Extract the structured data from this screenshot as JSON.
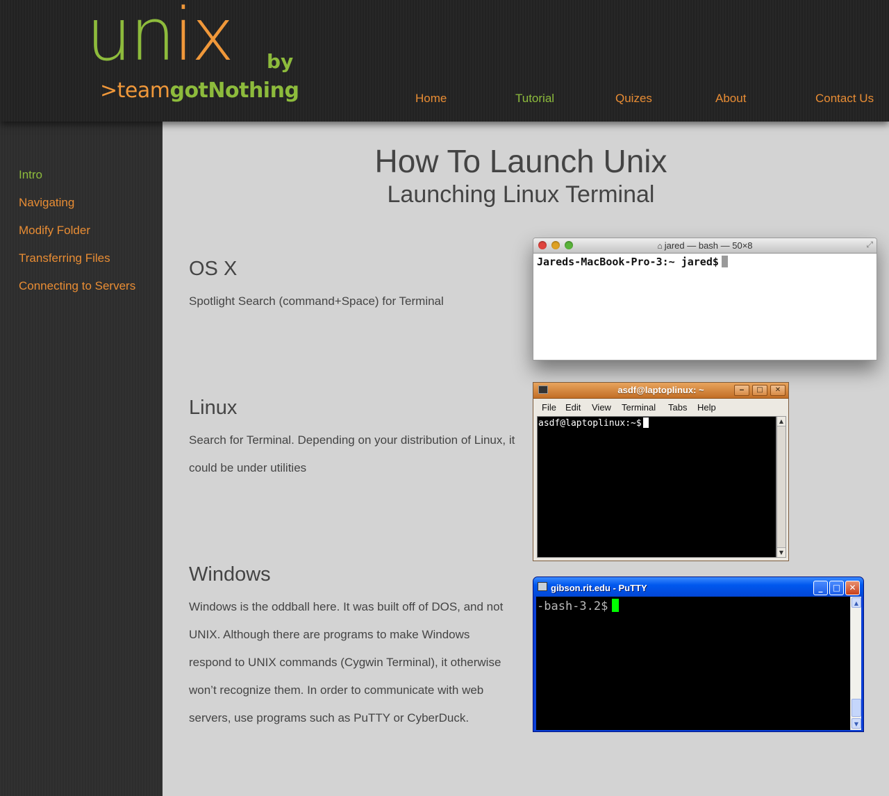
{
  "logo": {
    "unix_part1": "un",
    "unix_part2": "ix",
    "by": "by",
    "team_prefix": ">team",
    "team_name": "gotNothing"
  },
  "nav": {
    "items": [
      {
        "label": "Home"
      },
      {
        "label": "Tutorial"
      },
      {
        "label": "Quizes"
      },
      {
        "label": "About"
      },
      {
        "label": "Contact Us"
      }
    ],
    "active_index": 1
  },
  "sidebar": {
    "items": [
      {
        "label": "Intro"
      },
      {
        "label": "Navigating"
      },
      {
        "label": "Modify Folder"
      },
      {
        "label": "Transferring Files"
      },
      {
        "label": "Connecting to Servers"
      }
    ],
    "active_index": 0
  },
  "main": {
    "title": "How To Launch Unix",
    "subtitle": "Launching Linux Terminal",
    "sections": [
      {
        "heading": "OS X",
        "body": "Spotlight Search (command+Space) for Terminal"
      },
      {
        "heading": "Linux",
        "body": "Search for Terminal. Depending on your distribution of Linux, it could be under utilities"
      },
      {
        "heading": "Windows",
        "body": "Windows is the oddball here. It was built off of DOS, and not UNIX. Although there are programs to make Windows respond to UNIX commands (Cygwin Terminal), it otherwise won’t recognize them. In order to communicate with web servers, use programs such as PuTTY or CyberDuck."
      }
    ]
  },
  "screenshots": {
    "mac": {
      "home_icon": "house-icon",
      "title": "jared — bash — 50×8",
      "prompt": "Jareds-MacBook-Pro-3:~ jared$"
    },
    "linux": {
      "title": "asdf@laptoplinux: ~",
      "menu": [
        "File",
        "Edit",
        "View",
        "Terminal",
        "Tabs",
        "Help"
      ],
      "prompt": "asdf@laptoplinux:~$"
    },
    "putty": {
      "title": "gibson.rit.edu - PuTTY",
      "prompt": "-bash-3.2$"
    }
  },
  "colors": {
    "accent_orange": "#e98d34",
    "accent_green": "#8dbb3c",
    "header_bg": "#222222",
    "sidebar_bg": "#2d2d2d",
    "content_bg": "#d3d3d3",
    "text": "#444444"
  }
}
